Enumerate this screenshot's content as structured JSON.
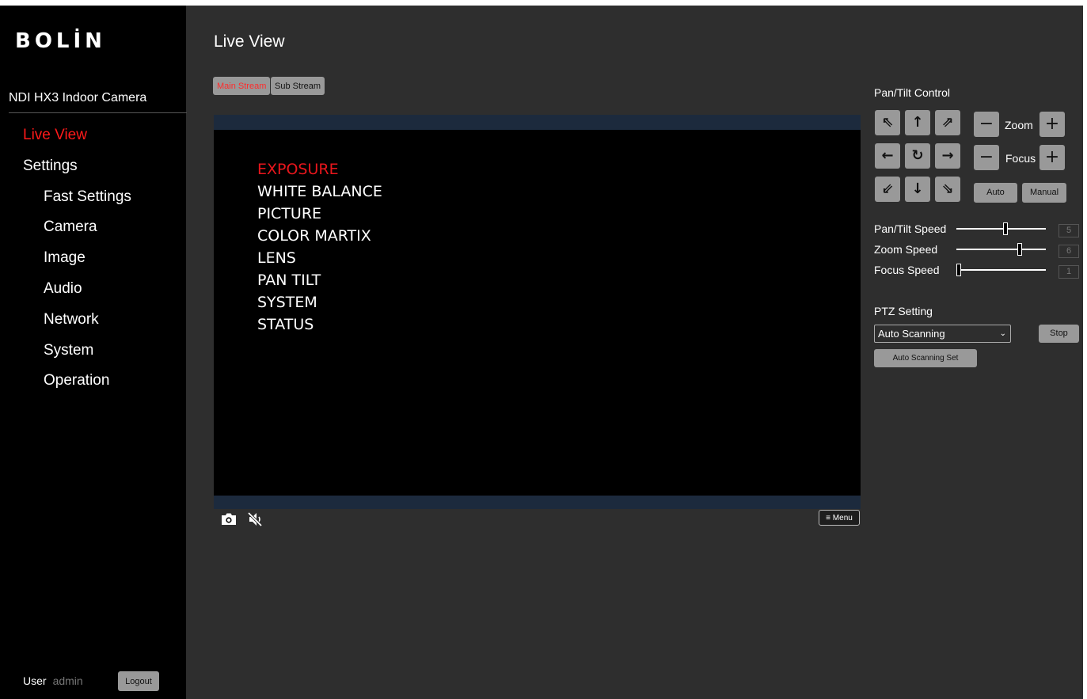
{
  "brand": {
    "logo_text": "BOLİN"
  },
  "sidebar": {
    "device_name": "NDI HX3 Indoor Camera",
    "items": [
      {
        "label": "Live View",
        "active": true
      },
      {
        "label": "Settings"
      },
      {
        "label": "Fast Settings"
      },
      {
        "label": "Camera"
      },
      {
        "label": "Image"
      },
      {
        "label": "Audio"
      },
      {
        "label": "Network"
      },
      {
        "label": "System"
      },
      {
        "label": "Operation"
      }
    ],
    "user_label": "User",
    "user_name": "admin",
    "logout_label": "Logout"
  },
  "main": {
    "title": "Live View",
    "streams": {
      "main_label": "Main Stream",
      "sub_label": "Sub Stream",
      "selected": "Main Stream"
    },
    "osd_menu": {
      "items": [
        "EXPOSURE",
        "WHITE BALANCE",
        "PICTURE",
        "COLOR MARTIX",
        "LENS",
        "PAN TILT",
        "SYSTEM",
        "STATUS"
      ],
      "selected": "EXPOSURE"
    },
    "video_toolbar": {
      "snapshot_icon": "camera-icon",
      "mute_icon": "speaker-muted-icon",
      "menu_label": "Menu",
      "menu_icon": "hamburger-icon"
    }
  },
  "ptz": {
    "pan_tilt_title": "Pan/Tilt Control",
    "arrows": {
      "up_left": "⇖",
      "up": "↑",
      "up_right": "⇗",
      "left": "←",
      "home": "↻",
      "right": "→",
      "down_left": "⇙",
      "down": "↓",
      "down_right": "⇘"
    },
    "zoom_label": "Zoom",
    "focus_label": "Focus",
    "minus_symbol": "−",
    "plus_symbol": "+",
    "focus_auto_label": "Auto",
    "focus_manual_label": "Manual",
    "speeds": [
      {
        "label": "Pan/Tilt Speed",
        "value": "5",
        "level": 0.55
      },
      {
        "label": "Zoom Speed",
        "value": "6",
        "level": 0.72
      },
      {
        "label": "Focus Speed",
        "value": "1",
        "level": 0.0
      }
    ],
    "setting_title": "PTZ Setting",
    "mode_selected": "Auto Scanning",
    "stop_label": "Stop",
    "scan_set_label": "Auto Scanning Set"
  },
  "colors": {
    "accent": "#ff1a1a",
    "background": "#2e2e2e",
    "sidebar": "#000000",
    "button": "#999999"
  }
}
